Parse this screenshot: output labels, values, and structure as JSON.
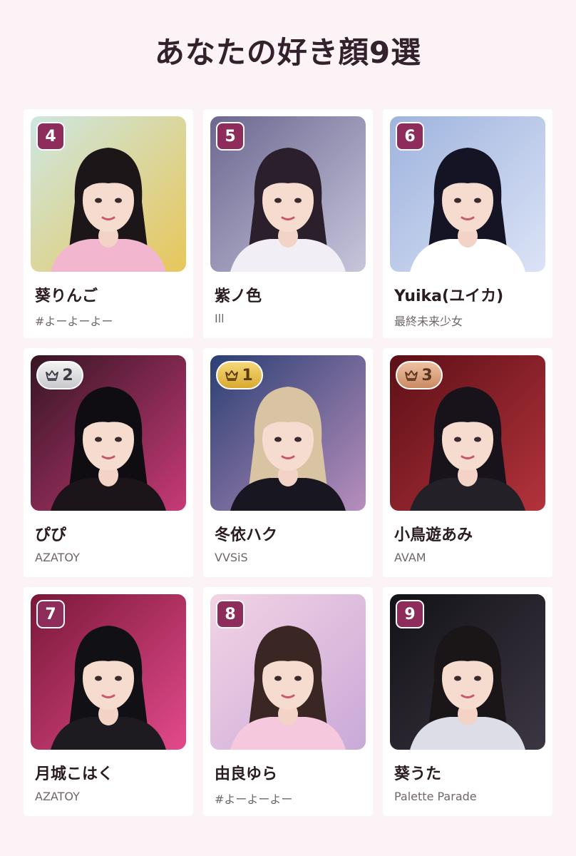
{
  "title": "あなたの好き顔9選",
  "colors": {
    "background": "#fbf3f5",
    "badge": "#8e2c5b",
    "gold": "#e4b845",
    "silver": "#d6d6da",
    "bronze": "#d69a72"
  },
  "cards": [
    {
      "rank": "4",
      "name": "葵りんご",
      "group": "#よーよーよー",
      "badge_style": "plain",
      "bg1": "#cde7e2",
      "bg2": "#e8c65a",
      "hair": "#1c1618",
      "outfit": "#f3b6cf"
    },
    {
      "rank": "5",
      "name": "紫ノ色",
      "group": "Ill",
      "badge_style": "plain",
      "bg1": "#6c6790",
      "bg2": "#c7c6dc",
      "hair": "#2a1f2b",
      "outfit": "#f1eef6"
    },
    {
      "rank": "6",
      "name": "Yuika(ユイカ)",
      "group": "最終未来少女",
      "badge_style": "plain",
      "bg1": "#9fb3de",
      "bg2": "#dbe3f6",
      "hair": "#141425",
      "outfit": "#ffffff"
    },
    {
      "rank": "2",
      "name": "ぴぴ",
      "group": "AZATOY",
      "badge_style": "silver",
      "bg1": "#351524",
      "bg2": "#c83a77",
      "hair": "#0f0d12",
      "outfit": "#1b1419"
    },
    {
      "rank": "1",
      "name": "冬依ハク",
      "group": "VVSiS",
      "badge_style": "gold",
      "bg1": "#2b3f73",
      "bg2": "#b78fbd",
      "hair": "#d8c3a3",
      "outfit": "#181620"
    },
    {
      "rank": "3",
      "name": "小鳥遊あみ",
      "group": "AVAM",
      "badge_style": "bronze",
      "bg1": "#5d0f16",
      "bg2": "#b3333c",
      "hair": "#18121a",
      "outfit": "#242028"
    },
    {
      "rank": "7",
      "name": "月城こはく",
      "group": "AZATOY",
      "badge_style": "plain",
      "bg1": "#7a1838",
      "bg2": "#e34a8b",
      "hair": "#111014",
      "outfit": "#1d1a20"
    },
    {
      "rank": "8",
      "name": "由良ゆら",
      "group": "#よーよーよー",
      "badge_style": "plain",
      "bg1": "#f3d3e4",
      "bg2": "#c9a9d8",
      "hair": "#3a2622",
      "outfit": "#f6c8de"
    },
    {
      "rank": "9",
      "name": "葵うた",
      "group": "Palette Parade",
      "badge_style": "plain",
      "bg1": "#131218",
      "bg2": "#3c3642",
      "hair": "#1a1517",
      "outfit": "#dcdde6"
    }
  ]
}
